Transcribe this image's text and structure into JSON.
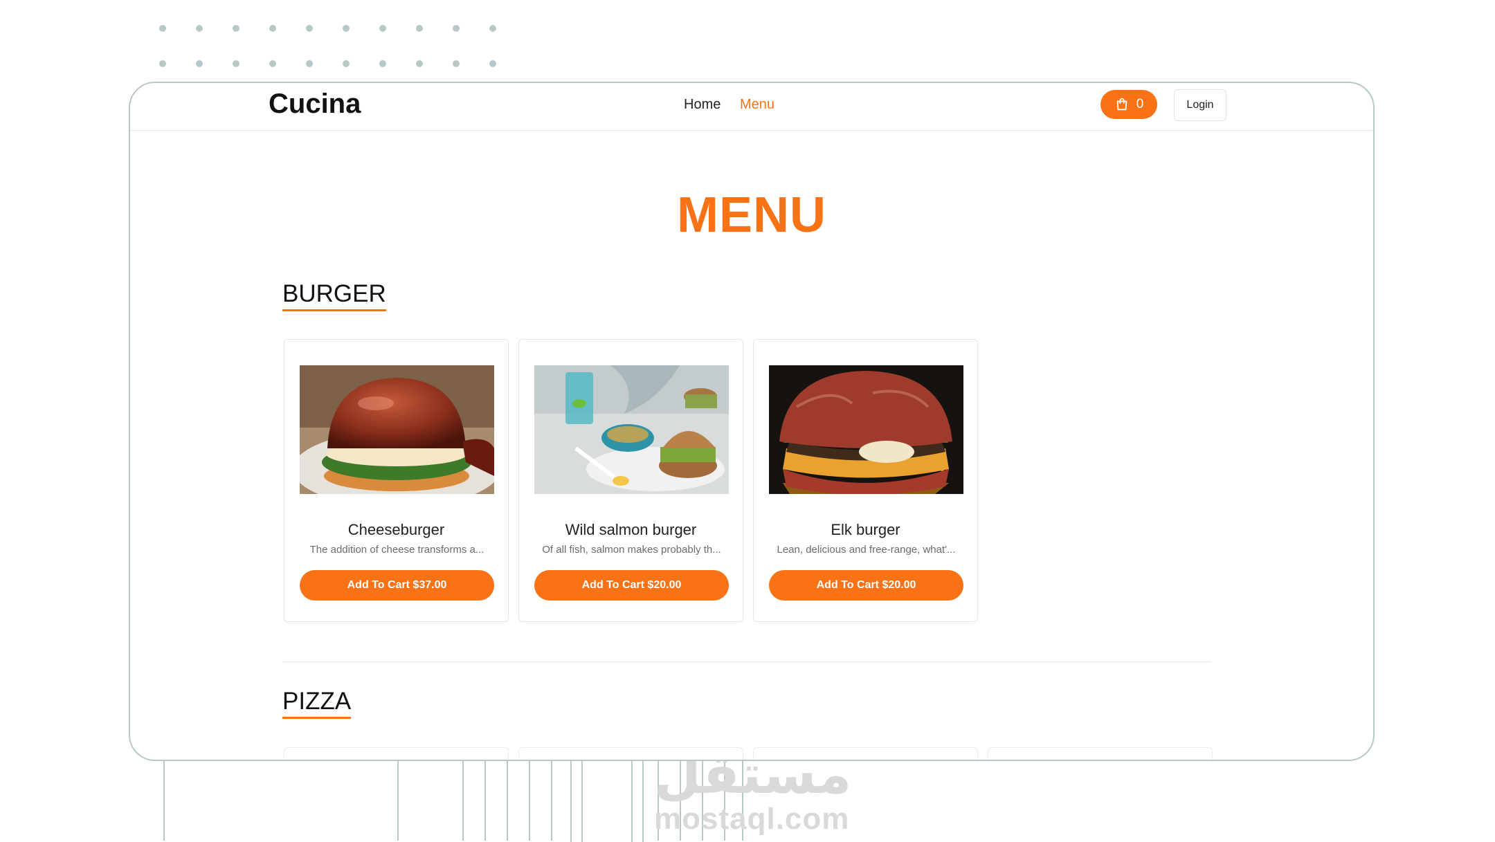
{
  "header": {
    "brand": "Cucina",
    "nav": {
      "home": "Home",
      "menu": "Menu"
    },
    "cart_count": "0",
    "login_label": "Login"
  },
  "page": {
    "title": "MENU"
  },
  "sections": [
    {
      "title": "BURGER",
      "items": [
        {
          "name": "Cheeseburger",
          "description": "The addition of cheese transforms a...",
          "button": "Add To Cart $37.00"
        },
        {
          "name": "Wild salmon burger",
          "description": "Of all fish, salmon makes probably th...",
          "button": "Add To Cart $20.00"
        },
        {
          "name": "Elk burger",
          "description": "Lean, delicious and free-range, what'...",
          "button": "Add To Cart $20.00"
        }
      ]
    },
    {
      "title": "PIZZA",
      "items": []
    }
  ],
  "watermark": {
    "arabic": "مستقل",
    "latin": "mostaql.com"
  },
  "colors": {
    "accent": "#f97316",
    "decor": "#b6c8c8"
  }
}
